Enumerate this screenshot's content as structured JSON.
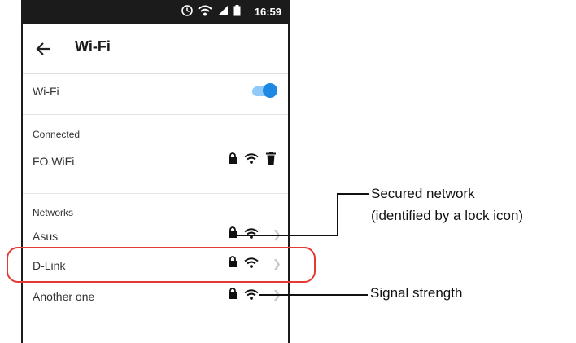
{
  "status_bar": {
    "time": "16:59"
  },
  "app_bar": {
    "title": "Wi-Fi"
  },
  "wifi_toggle": {
    "label": "Wi-Fi",
    "on": true
  },
  "connected": {
    "section_title": "Connected",
    "network": {
      "name": "FO.WiFi",
      "icons": [
        "lock-icon",
        "wifi-icon",
        "trash-icon"
      ]
    }
  },
  "networks": {
    "section_title": "Networks",
    "items": [
      {
        "name": "Asus",
        "icons": [
          "lock-icon",
          "wifi-icon",
          "chevron-right-icon"
        ]
      },
      {
        "name": "D-Link",
        "icons": [
          "lock-icon",
          "wifi-icon",
          "chevron-right-icon"
        ]
      },
      {
        "name": "Another one",
        "icons": [
          "lock-icon",
          "wifi-icon",
          "chevron-right-icon"
        ]
      }
    ]
  },
  "callouts": {
    "secured_line1": "Secured network",
    "secured_line2": "(identified by a lock icon)",
    "signal": "Signal strength"
  },
  "colors": {
    "accent": "#1e88e5",
    "highlight": "#e53935",
    "statusbar": "#1b1b1b"
  }
}
